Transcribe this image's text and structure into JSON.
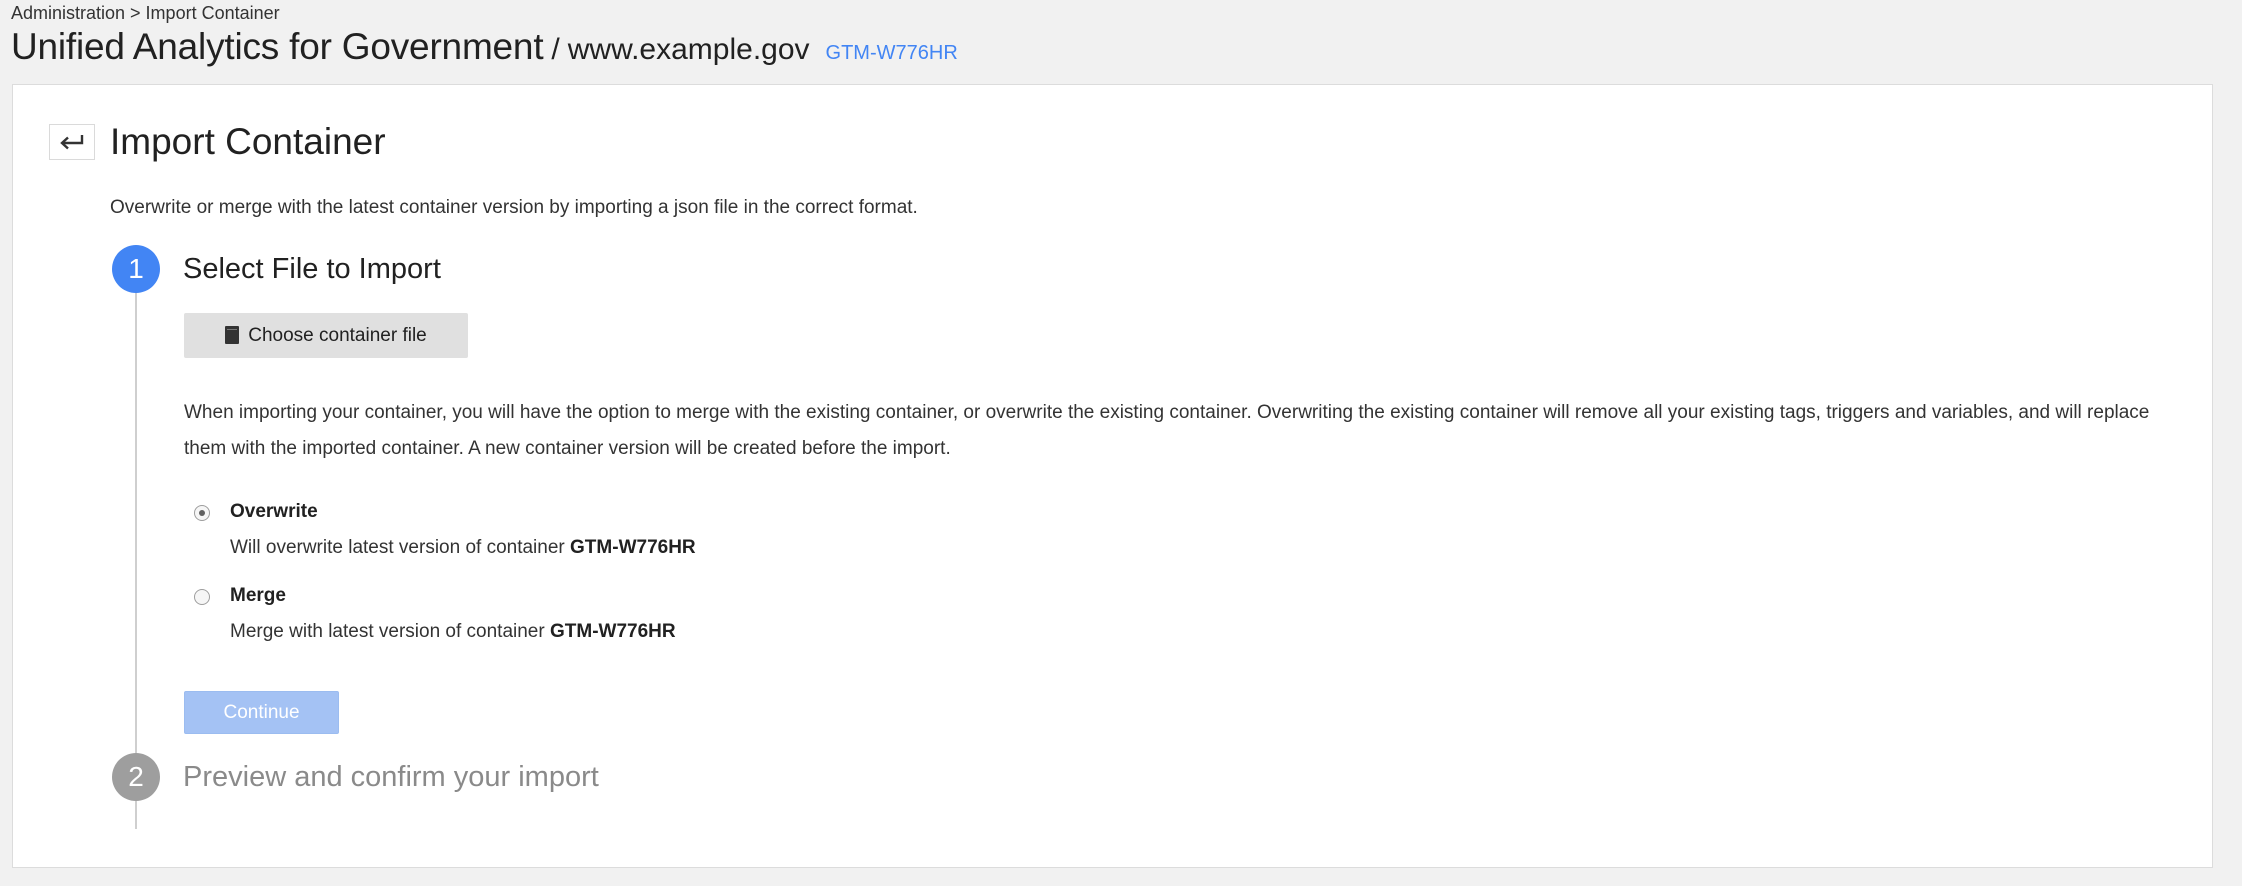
{
  "breadcrumb": "Administration > Import Container",
  "header": {
    "account_name": "Unified Analytics for Government",
    "separator": "/",
    "container_name": "www.example.gov",
    "container_id": "GTM-W776HR"
  },
  "page": {
    "heading": "Import Container",
    "description": "Overwrite or merge with the latest container version by importing a json file in the correct format."
  },
  "steps": [
    {
      "number": "1",
      "title": "Select File to Import",
      "state": "active"
    },
    {
      "number": "2",
      "title": "Preview and confirm your import",
      "state": "inactive"
    }
  ],
  "choose_file": {
    "label": "Choose container file",
    "icon": "file-icon"
  },
  "import_description": "When importing your container, you will have the option to merge with the existing container, or overwrite the existing container. Overwriting the existing container will remove all your existing tags, triggers and variables, and will replace them with the imported container. A new container version will be created before the import.",
  "options": {
    "overwrite": {
      "label": "Overwrite",
      "subtext": "Will overwrite latest version of container",
      "container_id": "GTM-W776HR",
      "selected": true
    },
    "merge": {
      "label": "Merge",
      "subtext": "Merge with latest version of container",
      "container_id": "GTM-W776HR",
      "selected": false
    }
  },
  "continue_label": "Continue",
  "colors": {
    "accent": "#4285f4",
    "continue_disabled": "#a4c2f4",
    "step_inactive": "#9e9e9e"
  },
  "back_icon": "return-arrow-icon"
}
